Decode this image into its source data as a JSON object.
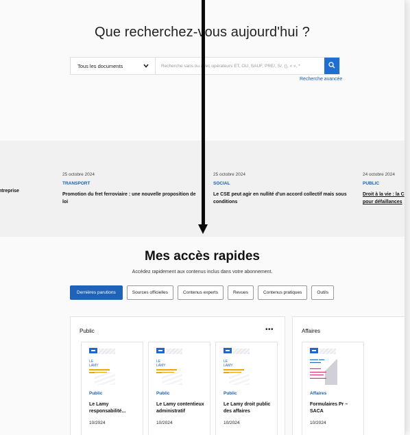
{
  "hero": {
    "title": "Que recherchez-vous aujourd'hui ?",
    "doc_select": "Tous les documents",
    "search_placeholder": "Recherche sans ou avec opérateurs ET, OU, SAUF, PRE/, S/, (), « », *",
    "advanced_link": "Recherche avancée"
  },
  "news": [
    {
      "date": "",
      "category": "",
      "title": "ntreprise",
      "underline": false
    },
    {
      "date": "25 octobre 2024",
      "category": "TRANSPORT",
      "title": "Promotion du fret ferroviaire : une nouvelle proposition de loi",
      "underline": false
    },
    {
      "date": "25 octobre 2024",
      "category": "SOCIAL",
      "title": "Le CSE peut agir en nullité d'un accord collectif mais sous conditions",
      "underline": false
    },
    {
      "date": "24 octobre 2024",
      "category": "PUBLIC",
      "title": "Droit à la vie : la C pour défaillances",
      "underline": true
    }
  ],
  "quick_access": {
    "title": "Mes accès rapides",
    "subtitle": "Accédez rapidement aux contenus inclus dans votre abonnement.",
    "tabs": [
      {
        "label": "Dernières parutions",
        "active": true
      },
      {
        "label": "Sources officielles",
        "active": false
      },
      {
        "label": "Contenus experts",
        "active": false
      },
      {
        "label": "Revues",
        "active": false
      },
      {
        "label": "Contenus pratiques",
        "active": false
      },
      {
        "label": "Outils",
        "active": false
      }
    ],
    "panels": [
      {
        "title": "Public",
        "more": "•••",
        "cards": [
          {
            "cover_line1": "LE",
            "cover_line2": "LAMY",
            "category": "Public",
            "title": "Le Lamy responsabilité...",
            "date": "10/2024"
          },
          {
            "cover_line1": "LE",
            "cover_line2": "LAMY",
            "category": "Public",
            "title": "Le Lamy contentieux administratif",
            "date": "10/2024"
          },
          {
            "cover_line1": "LE",
            "cover_line2": "LAMY",
            "category": "Public",
            "title": "Le Lamy droit public des affaires",
            "date": "10/2024"
          }
        ]
      },
      {
        "title": "Affaires",
        "cards": [
          {
            "cover_line1": "",
            "cover_line2": "",
            "category": "Affaires",
            "title": "Formulaires Pr – SACA",
            "date": "10/2024"
          }
        ]
      }
    ]
  },
  "colors": {
    "accent": "#1e63b8",
    "link": "#1a5fb4",
    "arrow": "#0a0a0a"
  }
}
